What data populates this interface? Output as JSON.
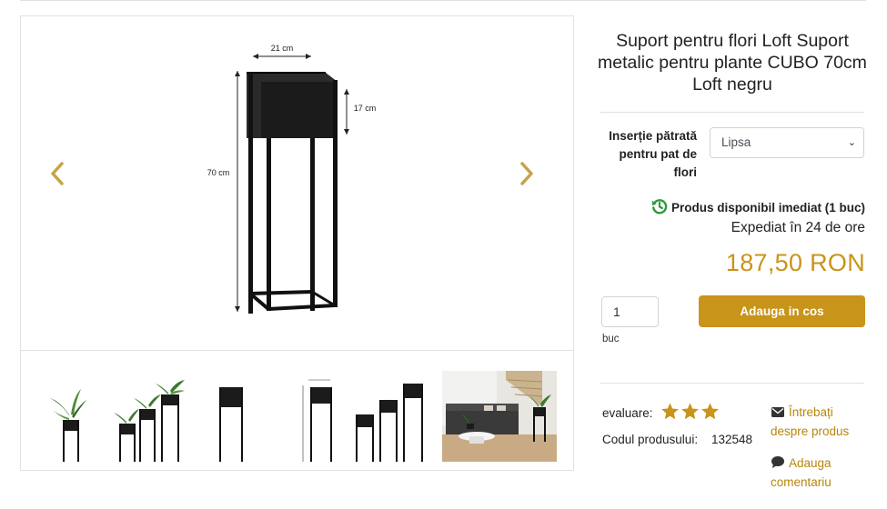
{
  "product": {
    "title": "Suport pentru flori Loft Suport metalic pentru plante CUBO 70cm Loft negru"
  },
  "gallery": {
    "dimensions": {
      "width_label": "21 cm",
      "pot_height_label": "17 cm",
      "total_height_label": "70 cm"
    },
    "prev_icon": "chevron-left-icon",
    "next_icon": "chevron-right-icon",
    "thumbnails": [
      "stand-with-plant",
      "three-stands-with-plants",
      "single-stand",
      "stand-with-dimensions",
      "three-stands",
      "living-room-scene"
    ]
  },
  "option": {
    "label": "Inserție pătrată pentru pat de flori",
    "selected": "Lipsa"
  },
  "availability": {
    "status": "Produs disponibil imediat (1 buc)",
    "shipping": "Expediat în 24 de ore",
    "icon": "history-icon",
    "color": "#2e9b3a"
  },
  "price": {
    "value": "187,50 RON",
    "color": "#c8941a"
  },
  "cart": {
    "quantity": "1",
    "unit": "buc",
    "add_label": "Adauga in cos"
  },
  "meta": {
    "rating_label": "evaluare:",
    "rating_stars": 3,
    "code_label": "Codul produsului:",
    "code_value": "132548"
  },
  "links": {
    "ask_label": "Întrebați despre produs",
    "ask_icon": "envelope-icon",
    "comment_label": "Adauga comentariu",
    "comment_icon": "comment-icon",
    "color": "#b8860b"
  }
}
